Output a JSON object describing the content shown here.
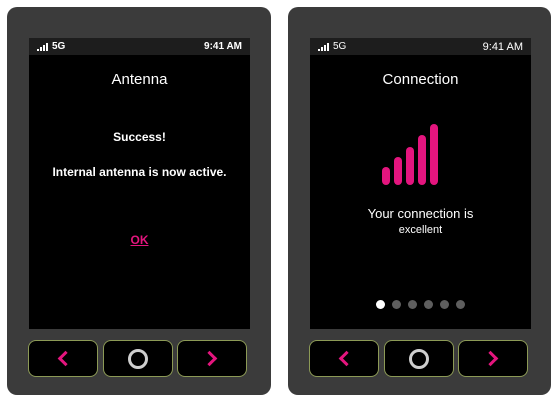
{
  "colors": {
    "accent": "#e4157e",
    "screen": "#000000",
    "device": "#3b3b3b",
    "statusbar": "#1d1d1d",
    "button_border": "#8c9a56"
  },
  "antenna_screen": {
    "status": {
      "network": "5G",
      "time": "9:41 AM"
    },
    "title": "Antenna",
    "success": "Success!",
    "message": "Internal antenna is now active.",
    "ok_label": "OK"
  },
  "connection_screen": {
    "status": {
      "network": "5G",
      "time": "9:41 AM"
    },
    "title": "Connection",
    "signal_bars": 5,
    "signal_bars_filled": 5,
    "line1": "Your connection is",
    "line2": "excellent",
    "pages": {
      "count": 6,
      "active": 1
    }
  },
  "hardware_buttons": {
    "icons": [
      "chevron-left-icon",
      "home-ring-icon",
      "chevron-right-icon"
    ]
  }
}
